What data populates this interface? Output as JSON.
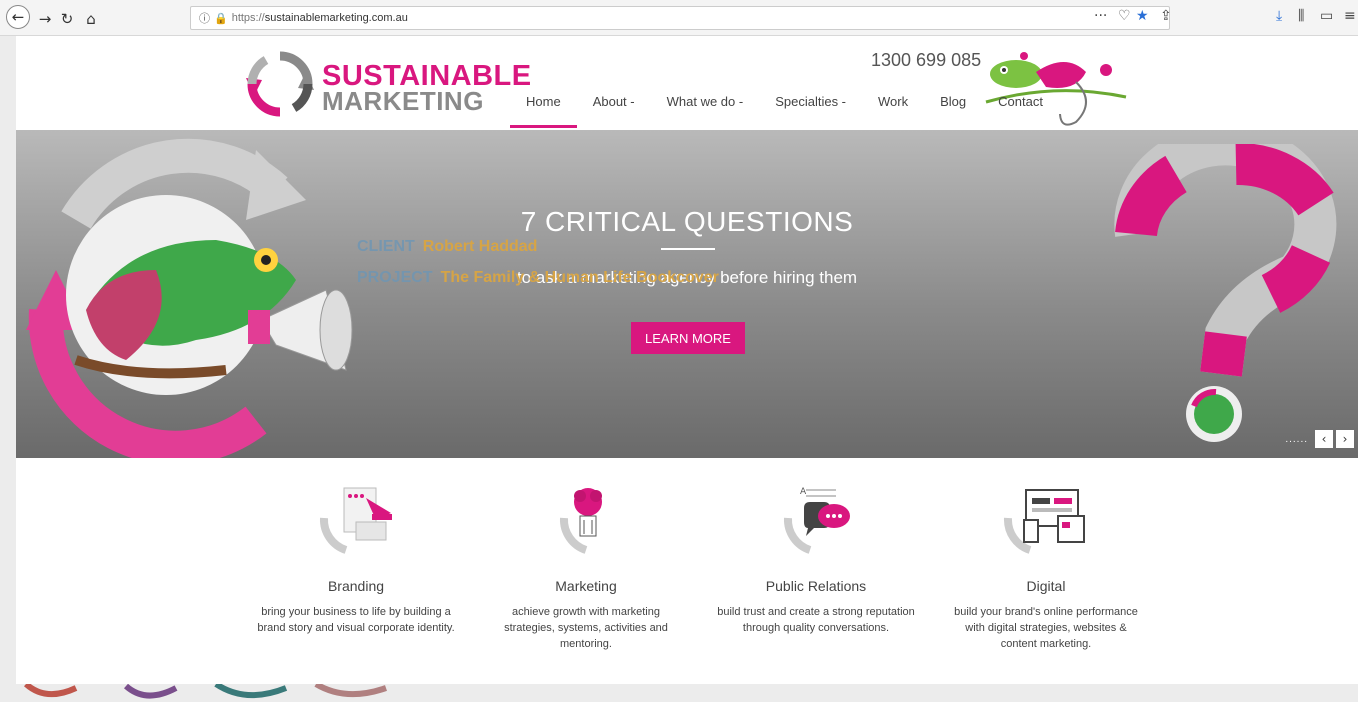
{
  "browser": {
    "url_prefix": "https://",
    "url_host": "sustainablemarketing.com.au",
    "colors": {
      "lock": "#2aa02a"
    }
  },
  "header": {
    "logo_line1": "SUSTAINABLE",
    "logo_line2": "MARKETING",
    "phone": "1300 699 085",
    "nav": [
      "Home",
      "About -",
      "What we do -",
      "Specialties -",
      "Work",
      "Blog",
      "Contact"
    ],
    "active_nav": "Home"
  },
  "hero": {
    "title": "7 CRITICAL QUESTIONS",
    "subtitle": "to ask a marketing agency before hiring them",
    "button_label": "LEARN MORE",
    "overlay": {
      "client_key": "CLIENT",
      "client_value": "Robert Haddad",
      "project_key": "PROJECT",
      "project_value": "The Family & Human Life Bookcover"
    },
    "slider_dots": "......",
    "prev_icon": "chevron-left-icon",
    "next_icon": "chevron-right-icon"
  },
  "services": [
    {
      "title": "Branding",
      "desc": "bring your business to life by building a brand story and visual corporate identity.",
      "icon": "branding-icon"
    },
    {
      "title": "Marketing",
      "desc": "achieve growth with marketing strategies, systems, activities and mentoring.",
      "icon": "lightbulb-icon"
    },
    {
      "title": "Public Relations",
      "desc": "build trust and create a strong reputation through quality conversations.",
      "icon": "speech-bubble-icon"
    },
    {
      "title": "Digital",
      "desc": "build your brand's online performance with digital strategies, websites & content marketing.",
      "icon": "devices-icon"
    }
  ],
  "colors": {
    "brand_pink": "#d9177f",
    "brand_grey": "#8a8a8a"
  }
}
